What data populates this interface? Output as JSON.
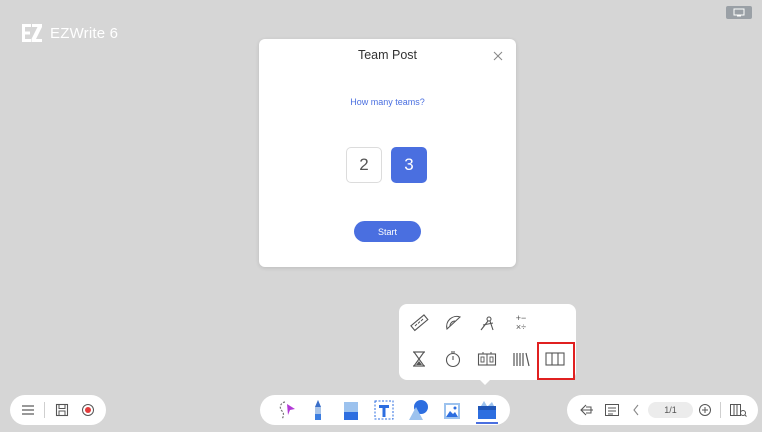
{
  "app": {
    "logo_text": "EZWrite 6"
  },
  "dialog": {
    "title": "Team Post",
    "question": "How many teams?",
    "options": [
      "2",
      "3"
    ],
    "selected": "3",
    "start_label": "Start"
  },
  "tools_popup": {
    "row1": [
      "ruler-icon",
      "protractor-icon",
      "compass-icon",
      "calculator-icon"
    ],
    "row2": [
      "hourglass-icon",
      "stopwatch-icon",
      "scoreboard-icon",
      "book-shelf-icon",
      "team-post-icon"
    ],
    "calculator_glyph_top": "+−",
    "calculator_glyph_bottom": "×÷"
  },
  "bottom_bar": {
    "left": [
      "menu-icon",
      "save-icon",
      "record-icon"
    ],
    "center": [
      "lasso-select-icon",
      "pen-icon",
      "eraser-icon",
      "text-icon",
      "shapes-icon",
      "image-icon",
      "toolbox-icon"
    ],
    "right": [
      "exit-icon",
      "page-list-icon",
      "prev-page-icon",
      "next-page-icon",
      "add-page-icon",
      "library-icon"
    ],
    "page_indicator": "1/1"
  },
  "colors": {
    "accent": "#4a6fe0",
    "highlight": "#e02020",
    "background": "#d6d6d6"
  }
}
